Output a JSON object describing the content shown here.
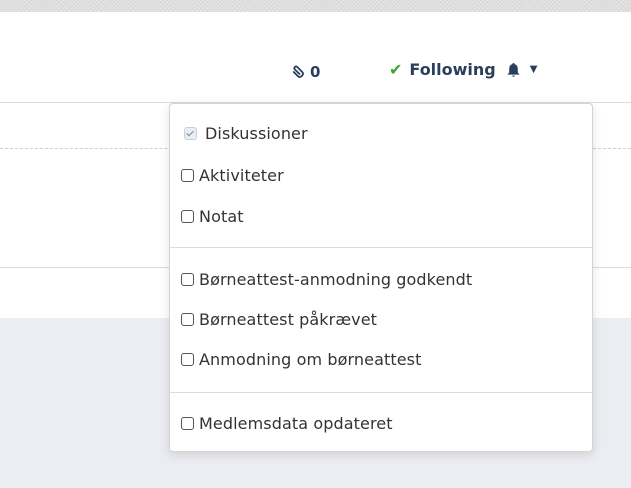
{
  "header": {
    "attachment_count": "0",
    "follow_label": "Following"
  },
  "dropdown": {
    "groups": [
      [
        {
          "label": "Diskussioner",
          "checked": true
        },
        {
          "label": "Aktiviteter",
          "checked": false
        },
        {
          "label": "Notat",
          "checked": false
        }
      ],
      [
        {
          "label": "Børneattest-anmodning godkendt",
          "checked": false
        },
        {
          "label": "Børneattest påkrævet",
          "checked": false
        },
        {
          "label": "Anmodning om børneattest",
          "checked": false
        }
      ],
      [
        {
          "label": "Medlemsdata opdateret",
          "checked": false
        }
      ]
    ]
  },
  "colors": {
    "accent_text": "#2a3f5c",
    "check_green": "#3aa43a",
    "panel_gray": "#ebedf2"
  },
  "icons": {
    "attachment": "paperclip-icon",
    "follow_check": "check-icon",
    "bell": "bell-icon",
    "caret": "caret-down-icon"
  }
}
